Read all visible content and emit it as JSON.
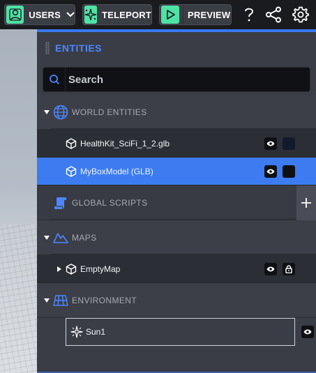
{
  "toolbar": {
    "users_label": "USERS",
    "teleport_label": "TELEPORT",
    "preview_label": "PREVIEW",
    "accent_color": "#4fe2a5",
    "icons": [
      "user-icon",
      "chevron-down-icon",
      "teleport-icon",
      "play-icon",
      "help-icon",
      "share-icon",
      "gear-icon"
    ]
  },
  "panel": {
    "title": "ENTITIES",
    "accent_color": "#3a78f2",
    "search": {
      "placeholder": "Search",
      "value": ""
    }
  },
  "sections": {
    "world": {
      "title": "WORLD ENTITIES",
      "icon": "globe-icon",
      "expanded": true
    },
    "scripts": {
      "title": "GLOBAL SCRIPTS",
      "icon": "script-icon"
    },
    "maps": {
      "title": "MAPS",
      "icon": "mountain-icon",
      "expanded": true
    },
    "environment": {
      "title": "ENVIRONMENT",
      "icon": "grid-icon",
      "expanded": true
    }
  },
  "entities": {
    "healthkit": {
      "label": "HealthKit_SciFi_1_2.glb",
      "icon": "cube-icon"
    },
    "boxmodel": {
      "label": "MyBoxModel (GLB)",
      "icon": "cube-icon",
      "selected": true
    },
    "emptymap": {
      "label": "EmptyMap",
      "icon": "cube-icon"
    },
    "sun": {
      "label": "Sun1",
      "icon": "sparkle-icon"
    }
  }
}
